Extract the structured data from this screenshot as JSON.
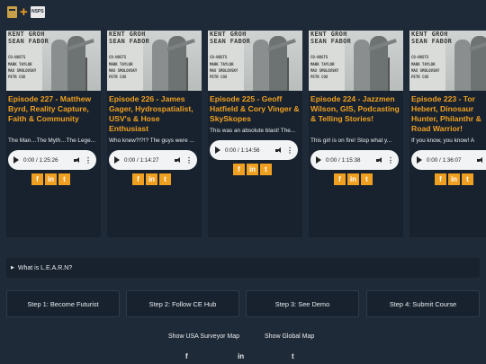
{
  "logos": {
    "left": "FE",
    "right": "NSPS"
  },
  "episodes": [
    {
      "title": "Episode 227 - Matthew Byrd, Reality Capture, Faith & Community",
      "desc": "The Man…The Myth…The Lege...",
      "player": {
        "time": "0:00 / 1:25:26"
      }
    },
    {
      "title": "Episode 226 - James Gager, Hydrospatialist, USV's & Hose Enthusiast",
      "desc": "Who knew?!?!? The guys were ...",
      "player": {
        "time": "0:00 / 1:14:27"
      }
    },
    {
      "title": "Episode 225 - Geoff Hatfield & Cory Vinger & SkySkopes",
      "desc": "This was an absolute blast! The...",
      "player": {
        "time": "0:00 / 1:14:56"
      }
    },
    {
      "title": "Episode 224 - Jazzmen Wilson, GIS, Podcasting & Telling Stories!",
      "desc": "This girl is on fire! Stop what y...",
      "player": {
        "time": "0:00 / 1:15:38"
      }
    },
    {
      "title": "Episode 223 - Tor Hebert, Dinosaur Hunter, Philanthr & Road Warrior!",
      "desc": "If you know, you know! A",
      "player": {
        "time": "0:00 / 1:36:07"
      }
    }
  ],
  "thumbnail": {
    "host1": "KENT GROH",
    "host2": "SEAN FABOR",
    "cohosts": [
      "CO-HOSTS",
      "MARK TAYLOR",
      "MAX SMOLOVSKY",
      "PETR COX"
    ]
  },
  "social_icons": [
    "facebook-icon",
    "linkedin-icon",
    "twitter-icon"
  ],
  "social_glyphs": {
    "facebook": "f",
    "linkedin": "in",
    "twitter": "t"
  },
  "accordion": {
    "arrow": "▶",
    "label": "What is L.E.A.R.N?"
  },
  "steps": [
    "Step 1: Become Futurist",
    "Step 2: Follow CE Hub",
    "Step 3: See Demo",
    "Step 4: Submit Course"
  ],
  "map_links": {
    "usa": "Show USA Surveyor Map",
    "global": "Show Global Map"
  },
  "colors": {
    "accent": "#f0a020",
    "background": "#1f2a38",
    "card": "#18222e"
  }
}
